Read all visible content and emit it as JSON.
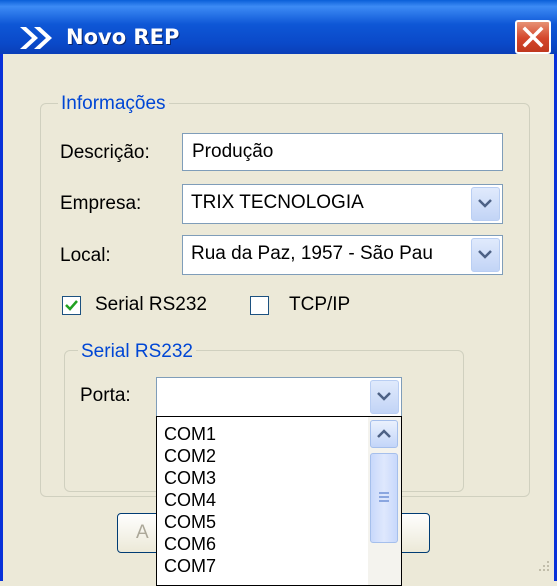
{
  "window": {
    "title": "Novo REP"
  },
  "info_group": {
    "legend": "Informações",
    "descricao": {
      "label": "Descrição:",
      "value": "Produção"
    },
    "empresa": {
      "label": "Empresa:",
      "value": "TRIX TECNOLOGIA"
    },
    "local": {
      "label": "Local:",
      "value": "Rua da Paz, 1957 - São Pau"
    },
    "serial_checkbox": {
      "label": "Serial RS232",
      "checked": true
    },
    "tcpip_checkbox": {
      "label": "TCP/IP",
      "checked": false
    }
  },
  "serial_group": {
    "legend": "Serial RS232",
    "porta": {
      "label": "Porta:",
      "value": ""
    }
  },
  "porta_options": [
    "COM1",
    "COM2",
    "COM3",
    "COM4",
    "COM5",
    "COM6",
    "COM7"
  ],
  "buttons": {
    "left_partial": "A"
  },
  "colors": {
    "title_bar": "#0a49c9",
    "accent": "#0046d5",
    "close": "#d4462b"
  }
}
